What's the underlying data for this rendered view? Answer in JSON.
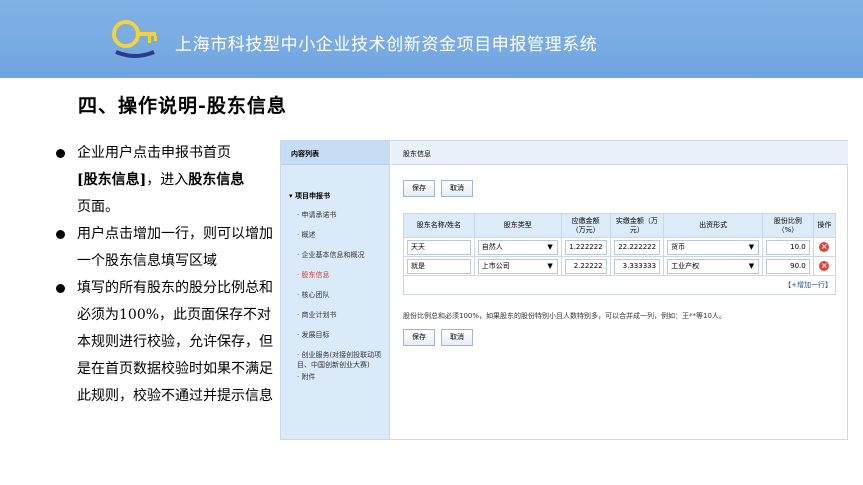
{
  "header": {
    "system_title": "上海市科技型中小企业技术创新资金项目申报管理系统"
  },
  "slide_title": "四、操作说明-股东信息",
  "bullets": [
    {
      "pre": "企业用户点击申报书首页",
      "bold1": "[股东信息]",
      "mid": "，进入",
      "bold2": "股东信息",
      "post": "页面。"
    },
    {
      "text": "用户点击增加一行，则可以增加一个股东信息填写区域"
    },
    {
      "text": "填写的所有股东的股分比例总和必须为100%，此页面保存不对本规则进行校验，允许保存，但是在首页数据校验时如果不满足此规则，校验不通过并提示信息"
    }
  ],
  "sidebar": {
    "header": "内容列表",
    "group": "项目申报书",
    "items": [
      "申请承诺书",
      "概述",
      "企业基本信息和概况",
      "股东信息",
      "核心团队",
      "商业计划书",
      "发展目标",
      "创业服务(对接创投联动项目、中国创新创业大赛)",
      "附件"
    ],
    "active_index": 3
  },
  "main": {
    "header": "股东信息",
    "save_label": "保存",
    "cancel_label": "取消",
    "columns": [
      "股东名称/姓名",
      "股东类型",
      "应缴金额（万元）",
      "实缴金额（万元）",
      "出资形式",
      "股份比例（%）",
      "操作"
    ],
    "rows": [
      {
        "name": "天天",
        "type": "自然人",
        "due": "1.222222",
        "paid": "22.222222",
        "form": "货币",
        "ratio": "10.0"
      },
      {
        "name": "就是",
        "type": "上市公司",
        "due": "2.22222",
        "paid": "3.333333",
        "form": "工业产权",
        "ratio": "90.0"
      }
    ],
    "add_row_label": "【+增加一行】",
    "note": "股份比例总和必须100%，如果股东的股份特别小且人数特别多，可以合并成一列，例如：王**等10人。"
  },
  "colors": {
    "banner": "#7fb0e6",
    "accent_red": "#e2443a"
  }
}
